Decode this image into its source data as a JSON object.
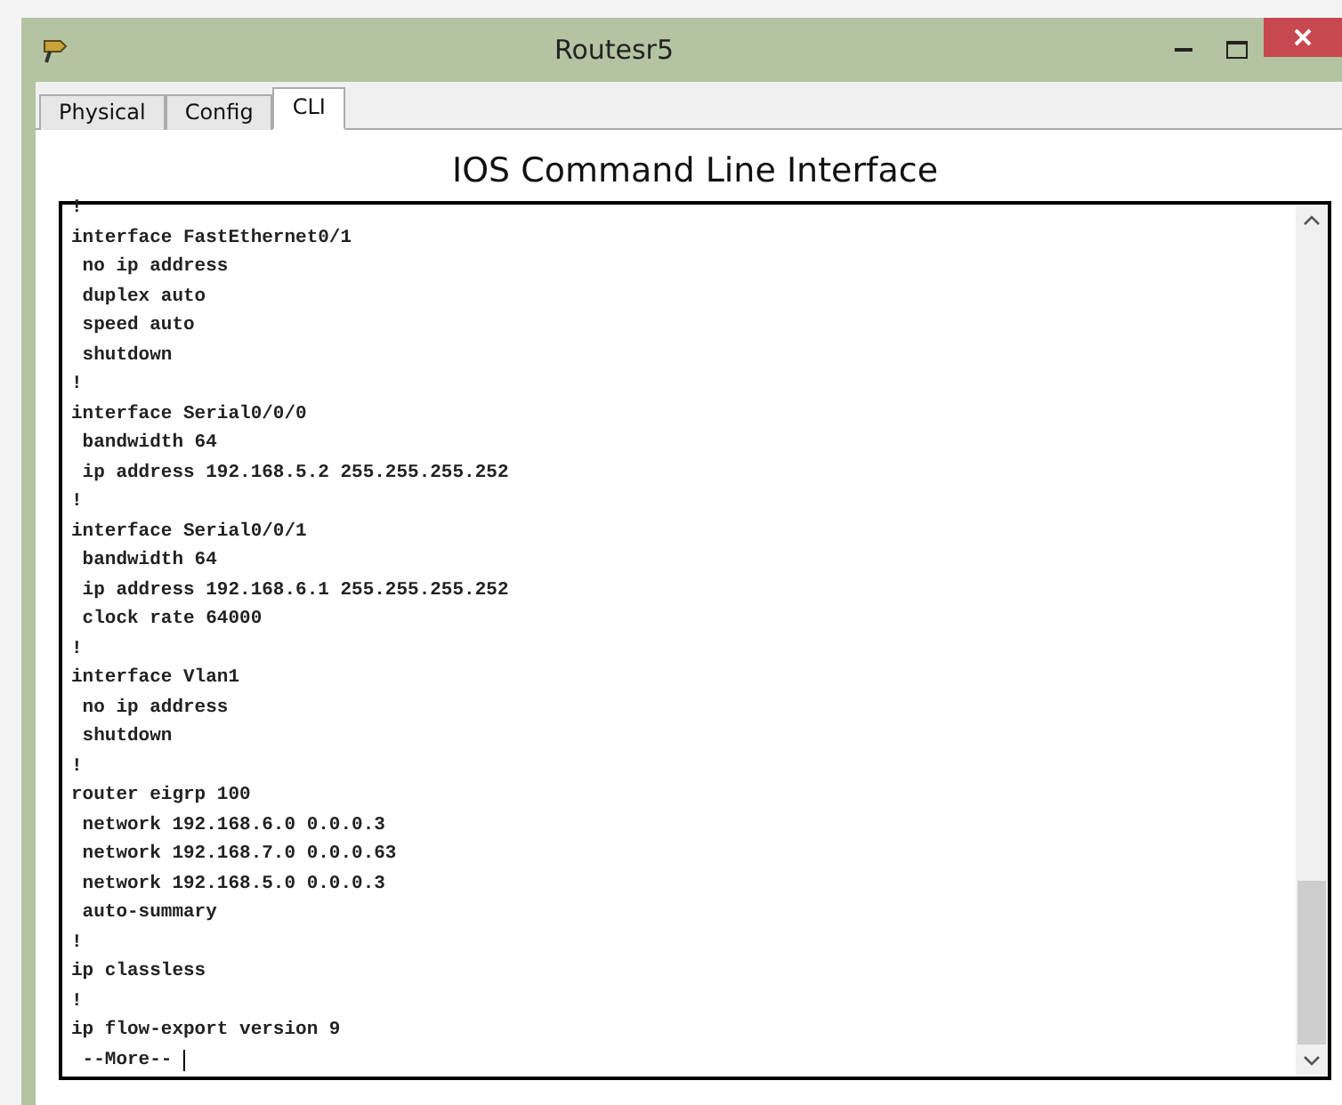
{
  "window": {
    "title": "Routesr5"
  },
  "tabs": [
    {
      "label": "Physical",
      "selected": false
    },
    {
      "label": "Config",
      "selected": false
    },
    {
      "label": "CLI",
      "selected": true
    }
  ],
  "heading": "IOS Command Line Interface",
  "terminal": {
    "lines": [
      "!",
      "interface FastEthernet0/1",
      " no ip address",
      " duplex auto",
      " speed auto",
      " shutdown",
      "!",
      "interface Serial0/0/0",
      " bandwidth 64",
      " ip address 192.168.5.2 255.255.255.252",
      "!",
      "interface Serial0/0/1",
      " bandwidth 64",
      " ip address 192.168.6.1 255.255.255.252",
      " clock rate 64000",
      "!",
      "interface Vlan1",
      " no ip address",
      " shutdown",
      "!",
      "router eigrp 100",
      " network 192.168.6.0 0.0.0.3",
      " network 192.168.7.0 0.0.0.63",
      " network 192.168.5.0 0.0.0.3",
      " auto-summary",
      "!",
      "ip classless",
      "!",
      "ip flow-export version 9"
    ],
    "prompt": " --More-- "
  }
}
